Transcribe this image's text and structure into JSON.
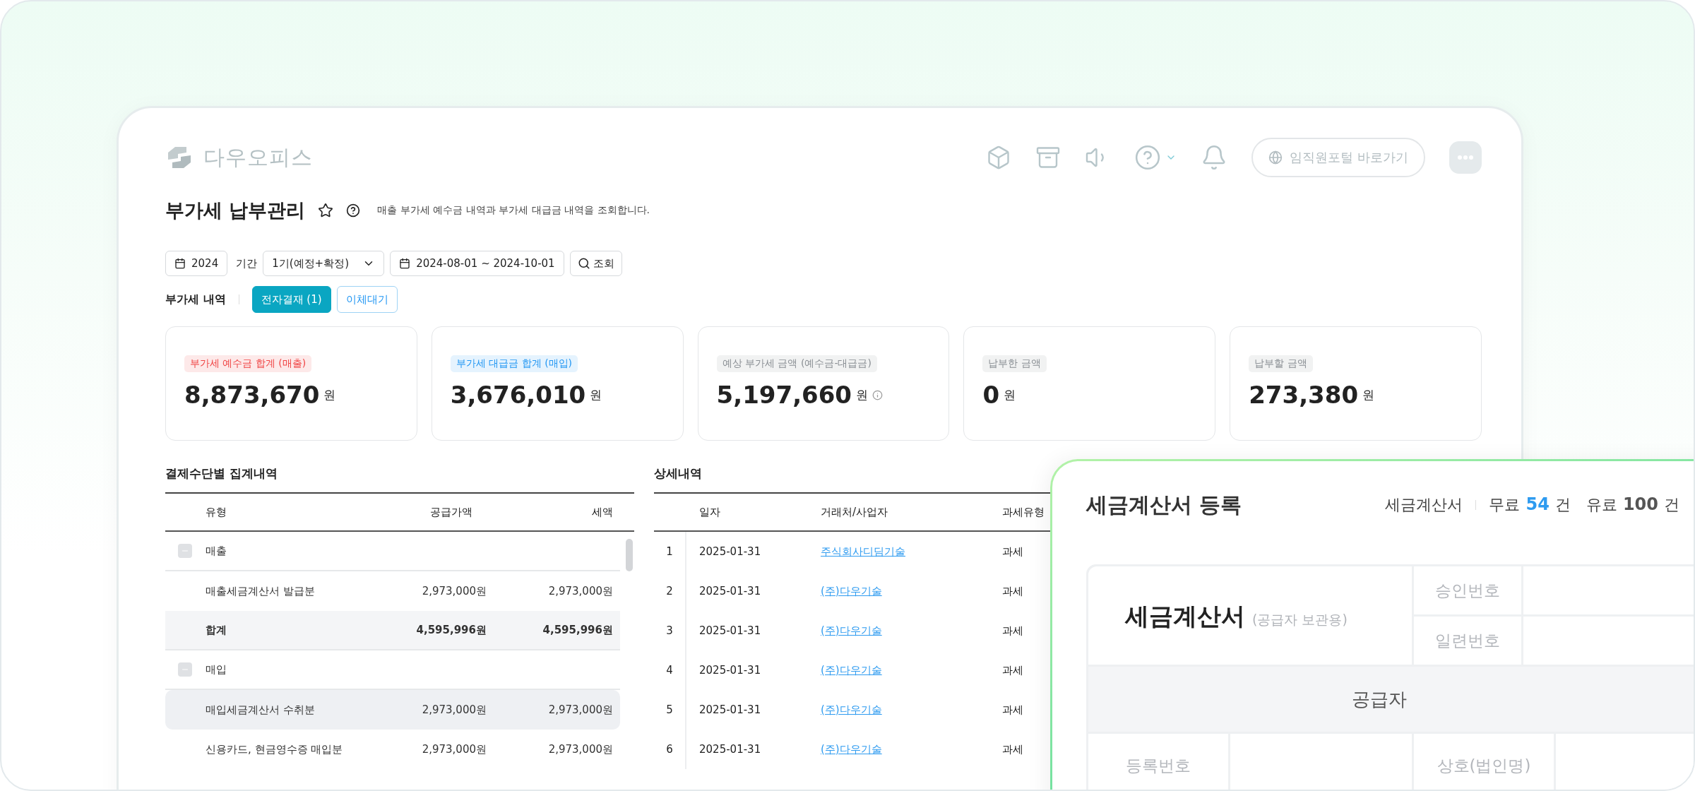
{
  "brand": {
    "name": "다우오피스"
  },
  "header": {
    "portal_button": "임직원포털 바로가기"
  },
  "page": {
    "title": "부가세 납부관리",
    "favorite": false,
    "description": "매출 부가세 예수금 내역과 부가세 대급금 내역을 조회합니다."
  },
  "filters": {
    "year": "2024",
    "period_label": "기간",
    "period": "1기(예정+확정)",
    "date_range": "2024-08-01 ~ 2024-10-01",
    "search_button": "조회"
  },
  "tabs": {
    "label": "부가세 내역",
    "items": [
      {
        "label": "전자결재 (1)",
        "selected": true
      },
      {
        "label": "이체대기",
        "selected": false
      }
    ]
  },
  "summary_cards": [
    {
      "label": "부가세 예수금 합계 (매출)",
      "color": "#f04444",
      "amount": "8,873,670",
      "unit": "원",
      "info": false
    },
    {
      "label": "부가세 대급금 합계 (매입)",
      "color": "#2196f3",
      "amount": "3,676,010",
      "unit": "원",
      "info": false
    },
    {
      "label": "예상 부가세 금액 (예수금-대급금)",
      "color": "#8a8f94",
      "amount": "5,197,660",
      "unit": "원",
      "info": true
    },
    {
      "label": "납부한 금액",
      "color": "#8a8f94",
      "amount": "0",
      "unit": "원",
      "info": false
    },
    {
      "label": "납부할 금액",
      "color": "#8a8f94",
      "amount": "273,380",
      "unit": "원",
      "info": false
    }
  ],
  "payment_summary": {
    "title": "결제수단별 집계내역",
    "columns": [
      "유형",
      "공급가액",
      "세액"
    ],
    "rows": [
      {
        "kind": "group",
        "type": "매출",
        "expanded": true,
        "selected": false
      },
      {
        "kind": "item",
        "type": "매출세금계산서 발급분",
        "supply": "2,973,000원",
        "tax": "2,973,000원",
        "selected": false
      },
      {
        "kind": "total",
        "type": "합계",
        "supply": "4,595,996원",
        "tax": "4,595,996원",
        "selected": false
      },
      {
        "kind": "group",
        "type": "매입",
        "expanded": true,
        "selected": false
      },
      {
        "kind": "item",
        "type": "매입세금계산서 수취분",
        "supply": "2,973,000원",
        "tax": "2,973,000원",
        "selected": true
      },
      {
        "kind": "item",
        "type": "신용카드, 현금영수증 매입분",
        "supply": "2,973,000원",
        "tax": "2,973,000원",
        "selected": false
      }
    ]
  },
  "details": {
    "title": "상세내역",
    "columns": [
      "일자",
      "거래처/사업자",
      "과세유형"
    ],
    "rows": [
      {
        "no": "1",
        "date": "2025-01-31",
        "partner": "주식회사디딤기술",
        "tax_type": "과세"
      },
      {
        "no": "2",
        "date": "2025-01-31",
        "partner": "(주)다우기술",
        "tax_type": "과세"
      },
      {
        "no": "3",
        "date": "2025-01-31",
        "partner": "(주)다우기술",
        "tax_type": "과세"
      },
      {
        "no": "4",
        "date": "2025-01-31",
        "partner": "(주)다우기술",
        "tax_type": "과세"
      },
      {
        "no": "5",
        "date": "2025-01-31",
        "partner": "(주)다우기술",
        "tax_type": "과세"
      },
      {
        "no": "6",
        "date": "2025-01-31",
        "partner": "(주)다우기술",
        "tax_type": "과세"
      }
    ]
  },
  "invoice_panel": {
    "title": "세금계산서 등록",
    "quota_label": "세금계산서",
    "free_label": "무료",
    "free_count": "54",
    "free_unit": "건",
    "paid_label": "유료",
    "paid_count": "100",
    "paid_unit": "건",
    "form": {
      "title": "세금계산서",
      "subtitle": "(공급자 보관용)",
      "approval_label": "승인번호",
      "serial_label": "일련번호",
      "section": "공급자",
      "fields": [
        {
          "label": "등록번호"
        },
        {
          "label": "상호(법인명)"
        }
      ]
    }
  }
}
